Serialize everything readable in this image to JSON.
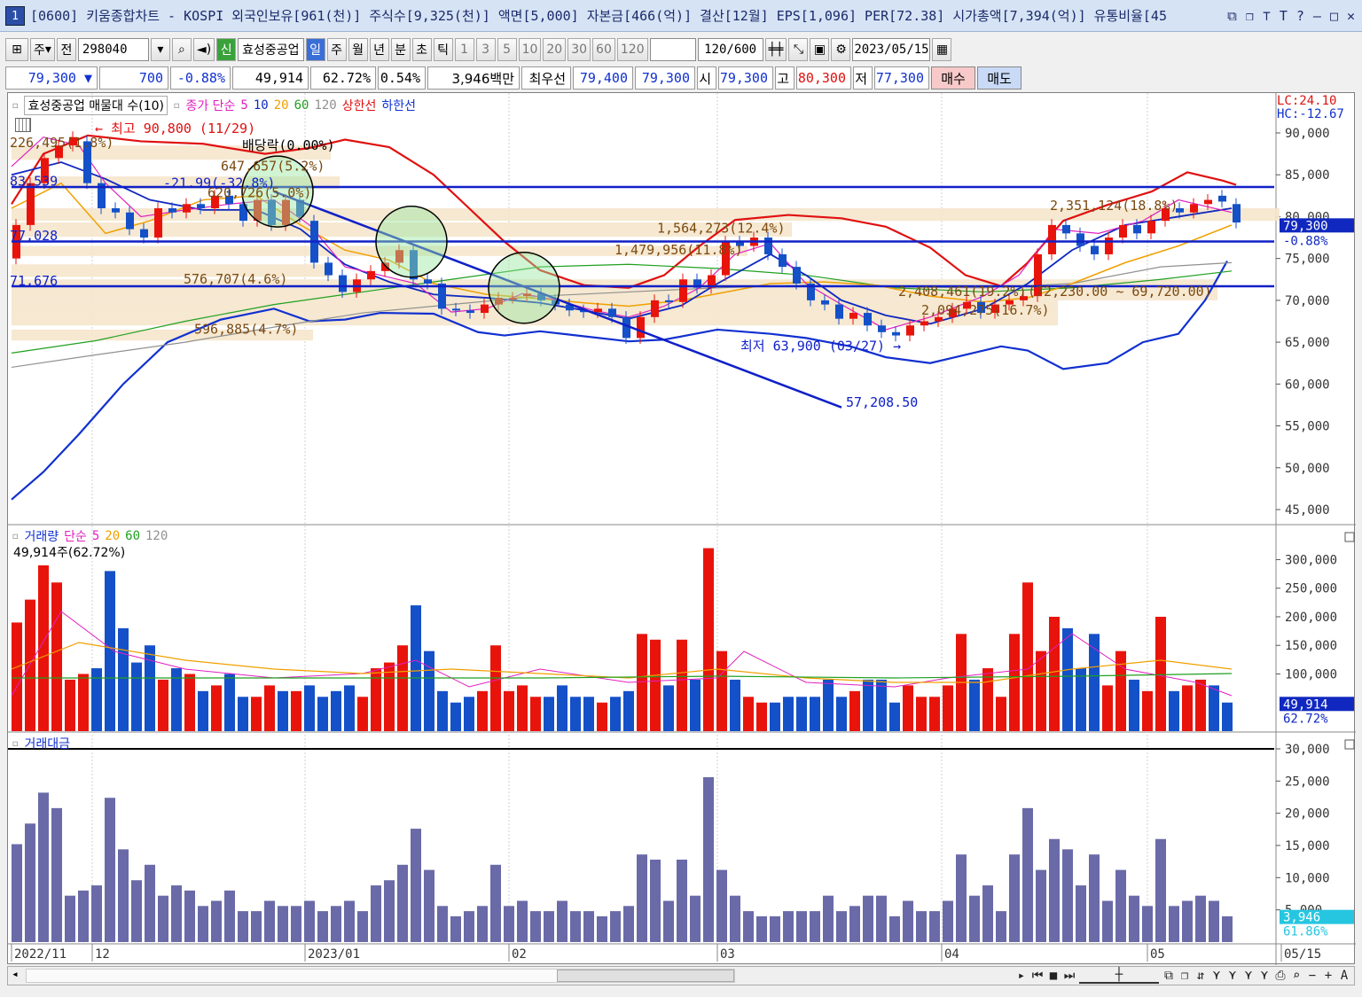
{
  "titlebar": {
    "num": "1",
    "text": "[0600] 키움종합차트 - KOSPI 외국인보유[961(천)] 주식수[9,325(천)] 액면[5,000] 자본금[466(억)] 결산[12월] EPS[1,096] PER[72.38] 시가총액[7,394(억)] 유통비율[45"
  },
  "toolbar": {
    "period_type": "주",
    "prev": "전",
    "code": "298040",
    "sin_badge": "신",
    "name": "효성중공업",
    "tabs": [
      "일",
      "주",
      "월",
      "년",
      "분",
      "초",
      "틱"
    ],
    "active_tab": "일",
    "intervals": [
      "1",
      "3",
      "5",
      "10",
      "20",
      "30",
      "60",
      "120"
    ],
    "count": "120",
    "count_total": "/600",
    "date": "2023/05/15"
  },
  "quote": {
    "price": "79,300",
    "change": "700",
    "change_pct": "-0.88%",
    "volume": "49,914",
    "vol_ratio": "62.72%",
    "turnover": "0.54%",
    "amount": "3,946백만",
    "best_label": "최우선",
    "ask": "79,400",
    "bid": "79,300",
    "open_label": "시",
    "open": "79,300",
    "high_label": "고",
    "high": "80,300",
    "low_label": "저",
    "low": "77,300",
    "buy": "매수",
    "sell": "매도"
  },
  "price_panel": {
    "legend": {
      "title": "효성중공업 매물대 수(10)",
      "ma_label": "종가 단순",
      "ma5": "5",
      "ma10": "10",
      "ma20": "20",
      "ma60": "60",
      "ma120": "120",
      "upper": "상한선",
      "lower": "하한선"
    },
    "lc": "LC:24.10",
    "hc": "HC:-12.67",
    "yaxis": [
      "90,000",
      "85,000",
      "80,000",
      "75,000",
      "70,000",
      "65,000",
      "60,000",
      "55,000",
      "50,000",
      "45,000"
    ],
    "current_price_tag": "79,300",
    "current_pct_tag": "-0.88%",
    "left_levels": [
      "226,495(1.8%)",
      "83,539",
      "77,028",
      "71,676"
    ],
    "annotations": {
      "high": "최고 90,800 (11/29)",
      "dividend": "배당락(0.00%)",
      "low": "최저 63,900 (03/27)",
      "trend_end": "57,208.50",
      "vp1": "647,657(5.2%)",
      "vp2": "-21.99(-32.8%)",
      "vp3": "576,707(4.6%)",
      "vp4": "596,885(4.7%)",
      "vp5": "1,564,273(12.4%)",
      "vp6": "1,479,956(11.8%)",
      "vp7": "2,351,124(18.8%)",
      "vp8": "2,408,461(19.2%)",
      "vp9": "2,094,275(16.7%)",
      "vp10": "(72,230.00 ~ 69,720.00)",
      "vp11": "620,726(5.0%)"
    }
  },
  "volume_panel": {
    "legend": {
      "title": "거래량",
      "ma_label": "단순",
      "ma5": "5",
      "ma20": "20",
      "ma60": "60",
      "ma120": "120"
    },
    "current": "49,914주(62.72%)",
    "yaxis": [
      "300,000",
      "250,000",
      "200,000",
      "150,000",
      "100,000"
    ],
    "tag_value": "49,914",
    "tag_pct": "62.72%"
  },
  "amount_panel": {
    "legend": {
      "title": "거래대금"
    },
    "yaxis": [
      "30,000",
      "25,000",
      "20,000",
      "15,000",
      "10,000",
      "5,000"
    ],
    "tag_value": "3,946",
    "tag_pct": "61.86%"
  },
  "xaxis": [
    "2022/11",
    "12",
    "2023/01",
    "02",
    "03",
    "04",
    "05",
    "05/15"
  ],
  "colors": {
    "up": "#e8140c",
    "down": "#1450c8",
    "amount_bar": "#6a6aa8",
    "ma5": "#e020c0",
    "ma10": "#1028c0",
    "ma20": "#f0a000",
    "ma60": "#20a020",
    "ma120": "#909090",
    "upper": "#e01010",
    "lower": "#1030d0"
  },
  "icons": {
    "minimize": "minimize-icon",
    "maximize": "maximize-icon",
    "close": "close-icon",
    "search": "search-icon",
    "calendar": "calendar-icon"
  }
}
